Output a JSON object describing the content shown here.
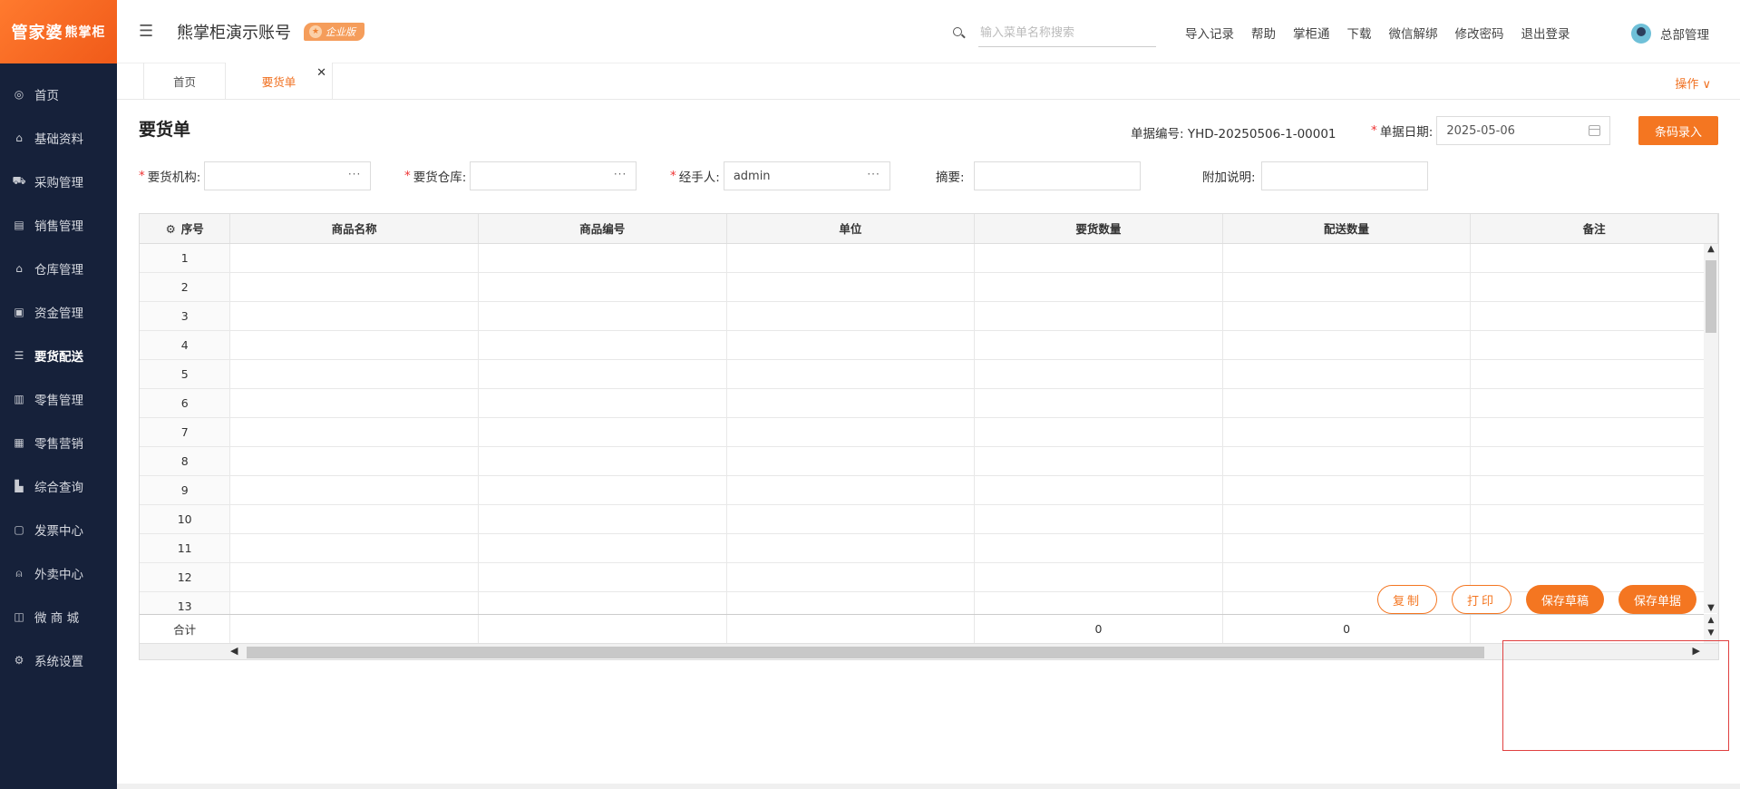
{
  "logo": {
    "main": "管家婆",
    "sub": "熊掌柜"
  },
  "sidebar": {
    "items": [
      {
        "label": "首页",
        "icon": "globe-icon"
      },
      {
        "label": "基础资料",
        "icon": "home-icon"
      },
      {
        "label": "采购管理",
        "icon": "cart-icon"
      },
      {
        "label": "销售管理",
        "icon": "sales-icon"
      },
      {
        "label": "仓库管理",
        "icon": "warehouse-icon"
      },
      {
        "label": "资金管理",
        "icon": "wallet-icon"
      },
      {
        "label": "要货配送",
        "icon": "list-icon"
      },
      {
        "label": "零售管理",
        "icon": "bar-chart-icon"
      },
      {
        "label": "零售营销",
        "icon": "gift-icon"
      },
      {
        "label": "综合查询",
        "icon": "chart-icon"
      },
      {
        "label": "发票中心",
        "icon": "invoice-icon"
      },
      {
        "label": "外卖中心",
        "icon": "alarm-icon"
      },
      {
        "label": "微 商 城",
        "icon": "shop-icon"
      },
      {
        "label": "系统设置",
        "icon": "gear-icon"
      }
    ],
    "active_index": 6
  },
  "header": {
    "account_name": "熊掌柜演示账号",
    "edition_badge": "企业版",
    "search_placeholder": "输入菜单名称搜索",
    "links": [
      "导入记录",
      "帮助",
      "掌柜通",
      "下载",
      "微信解绑",
      "修改密码",
      "退出登录"
    ],
    "user_name": "总部管理"
  },
  "tabs": {
    "items": [
      {
        "label": "首页"
      },
      {
        "label": "要货单"
      }
    ],
    "operations": "操作 ∨"
  },
  "form": {
    "title": "要货单",
    "doc_no_label": "单据编号:",
    "doc_no": "YHD-20250506-1-00001",
    "doc_date_label": "单据日期:",
    "doc_date": "2025-05-06",
    "barcode_button": "条码录入",
    "org_label": "要货机构:",
    "org_value": "",
    "warehouse_label": "要货仓库:",
    "warehouse_value": "",
    "handler_label": "经手人:",
    "handler_value": "admin",
    "summary_label": "摘要:",
    "summary_value": "",
    "note_label": "附加说明:",
    "note_value": "",
    "required_mark": "*",
    "ellipsis": "···"
  },
  "grid": {
    "columns": [
      "序号",
      "商品名称",
      "商品编号",
      "单位",
      "要货数量",
      "配送数量",
      "备注"
    ],
    "rows": [
      "1",
      "2",
      "3",
      "4",
      "5",
      "6",
      "7",
      "8",
      "9",
      "10",
      "11",
      "12",
      "13"
    ],
    "total_label": "合计",
    "total_request_qty": "0",
    "total_delivery_qty": "0"
  },
  "actions": {
    "copy": "复制",
    "print": "打印",
    "save_draft": "保存草稿",
    "save_doc": "保存单据"
  },
  "colors": {
    "accent": "#f47621",
    "sidebar_bg": "#16213a"
  }
}
